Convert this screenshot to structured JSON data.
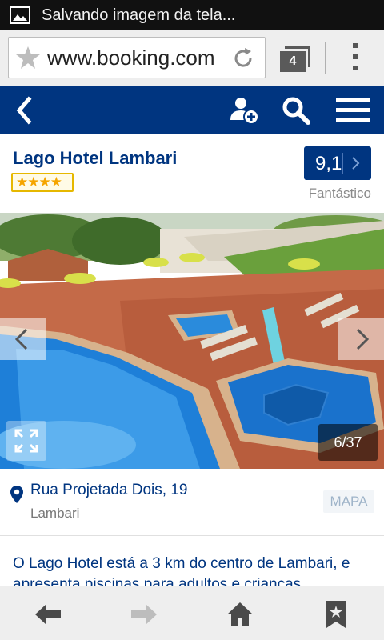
{
  "status_bar": {
    "notification_text": "Salvando imagem da tela...",
    "icon": "image-icon"
  },
  "browser": {
    "url": "www.booking.com",
    "tab_count": "4",
    "icons": [
      "star-icon",
      "reload-icon",
      "tabs-icon",
      "overflow-menu-icon"
    ]
  },
  "app_bar": {
    "icons": [
      "back-arrow-icon",
      "add-user-icon",
      "search-icon",
      "hamburger-menu-icon"
    ],
    "color": "#003580"
  },
  "hotel": {
    "name": "Lago Hotel Lambari",
    "star_rating": 4,
    "stars_text": "★★★★",
    "score": "9,1",
    "score_label": "Fantástico"
  },
  "gallery": {
    "counter": "6/37",
    "current_index": 6,
    "total": 37,
    "icons": [
      "chevron-left-icon",
      "chevron-right-icon",
      "expand-icon"
    ]
  },
  "location": {
    "street": "Rua Projetada Dois, 19",
    "city": "Lambari",
    "map_label": "MAPA",
    "icon": "map-pin-icon"
  },
  "description": {
    "text": "O Lago Hotel está a 3 km do centro de Lambari, e apresenta piscinas para adultos e crianças"
  },
  "bottom_bar": {
    "icons": [
      "back-arrow-icon",
      "forward-arrow-icon",
      "home-icon",
      "bookmark-icon"
    ]
  }
}
